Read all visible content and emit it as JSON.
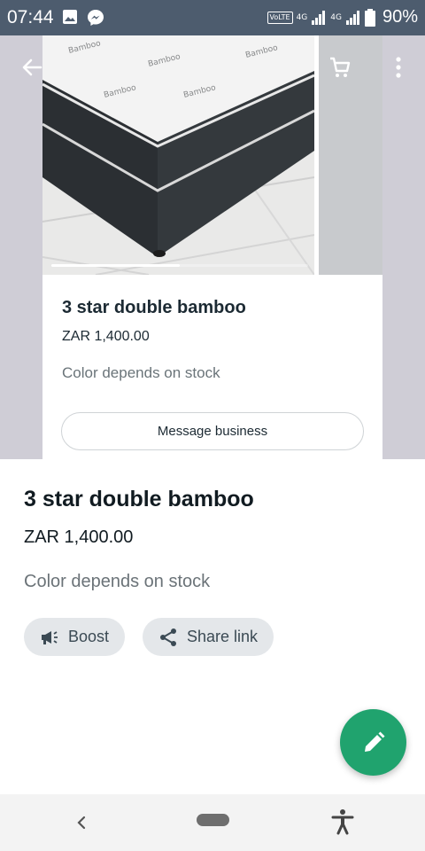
{
  "status_bar": {
    "time": "07:44",
    "volte": "VoLTE",
    "net1": "4G",
    "net2": "4G",
    "battery": "90%",
    "icons": [
      "image-icon",
      "messenger-icon",
      "signal-icon",
      "battery-icon"
    ]
  },
  "topbar": {
    "icons": [
      "back-arrow-icon",
      "cart-icon",
      "more-vert-icon"
    ]
  },
  "card": {
    "title": "3 star double bamboo",
    "price": "ZAR 1,400.00",
    "description": "Color depends on stock",
    "message_button": "Message business"
  },
  "details": {
    "title": "3 star double bamboo",
    "price": "ZAR 1,400.00",
    "description": "Color depends on stock"
  },
  "actions": {
    "boost": "Boost",
    "share": "Share link"
  },
  "gallery": {
    "progress": 0.5
  },
  "colors": {
    "accent": "#20a36e",
    "status_bar": "#4d5c6e",
    "hero_bg": "#cfcdd6"
  }
}
